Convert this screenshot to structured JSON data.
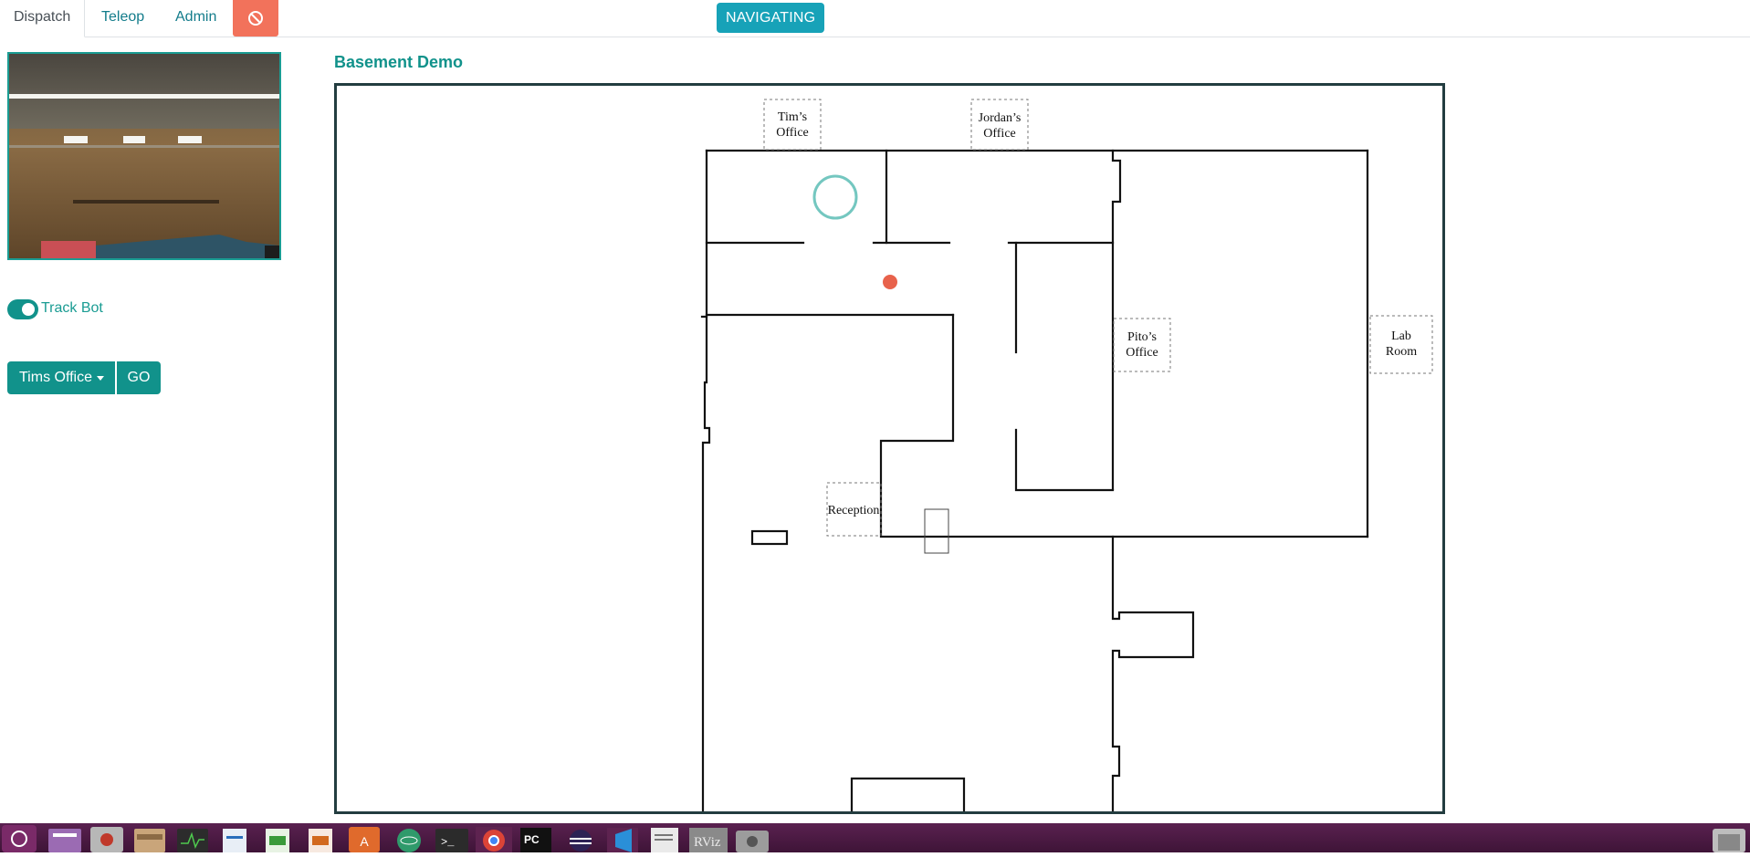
{
  "nav": {
    "tabs": [
      {
        "label": "Dispatch",
        "active": true
      },
      {
        "label": "Teleop",
        "active": false
      },
      {
        "label": "Admin",
        "active": false
      }
    ],
    "stop_icon": "prohibited-icon",
    "stop_color": "#f2725b"
  },
  "status": {
    "label": "NAVIGATING",
    "color": "#17a2b8"
  },
  "controls": {
    "track_bot_label": "Track Bot",
    "track_bot_on": true,
    "destination_selected": "Tims Office",
    "go_label": "GO",
    "accent": "#11928b"
  },
  "map": {
    "title": "Basement Demo",
    "rooms": {
      "tims_office": [
        "Tim’s",
        "Office"
      ],
      "jordans_office": [
        "Jordan’s",
        "Office"
      ],
      "pitos_office": [
        "Pito’s",
        "Office"
      ],
      "lab_room": [
        "Lab",
        "Room"
      ],
      "reception": [
        "Reception"
      ]
    },
    "robot_color": "#e8624b",
    "goal_color": "#74c7c0"
  },
  "taskbar": {
    "icons": [
      "ubuntu-icon",
      "window-icon",
      "settings-icon",
      "files-icon",
      "system-monitor-icon",
      "writer-icon",
      "calc-icon",
      "impress-icon",
      "software-icon",
      "atom-icon",
      "terminal-icon",
      "chrome-icon",
      "pycharm-icon",
      "eclipse-icon",
      "vscode-icon",
      "text-editor-icon",
      "rviz-icon",
      "camera-icon",
      "trash-icon"
    ]
  }
}
